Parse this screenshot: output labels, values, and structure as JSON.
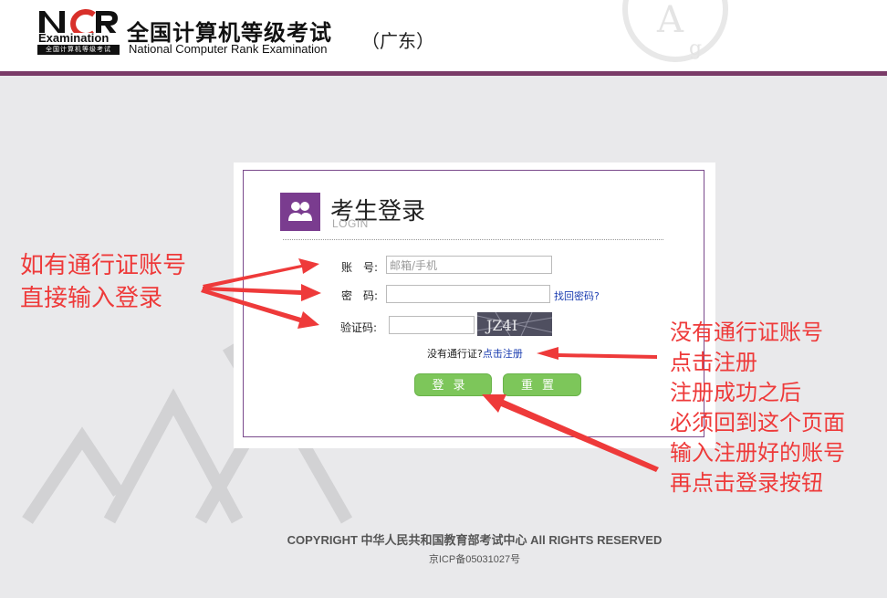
{
  "header": {
    "logo_letters": "NCR",
    "logo_exam": "Examination",
    "logo_sub": "全国计算机等级考试",
    "title_cn": "全国计算机等级考试",
    "title_en": "National Computer Rank Examination",
    "region": "（广东）"
  },
  "login": {
    "title": "考生登录",
    "subtitle": "LOGIN",
    "account_label": "账　号:",
    "account_placeholder": "邮箱/手机",
    "password_label": "密　码:",
    "forgot_password": "找回密码?",
    "captcha_label": "验证码:",
    "captcha_text": "JZ4I",
    "no_pass_text": "没有通行证?",
    "register_link": "点击注册",
    "login_button": "登录",
    "reset_button": "重置"
  },
  "annotations": {
    "left": [
      "如有通行证账号",
      "直接输入登录"
    ],
    "right": [
      "没有通行证账号",
      "点击注册",
      "注册成功之后",
      "必须回到这个页面",
      "输入注册好的账号",
      "再点击登录按钮"
    ]
  },
  "footer": {
    "copyright": "COPYRIGHT 中华人民共和国教育部考试中心 All RIGHTS RESERVED",
    "icp": "京ICP备05031027号"
  },
  "colors": {
    "brand_purple": "#7a3b68",
    "button_green": "#7dc65a",
    "annotation_red": "#ee3a3a",
    "link_blue": "#1a3cb0"
  }
}
